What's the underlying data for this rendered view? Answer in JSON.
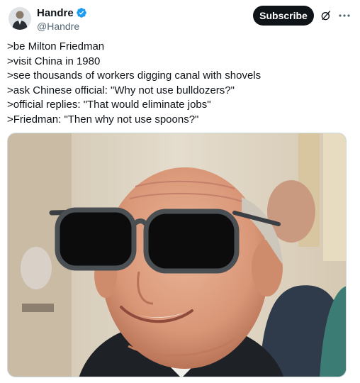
{
  "author": {
    "display_name": "Handre",
    "handle": "@Handre",
    "verified": true
  },
  "actions": {
    "subscribe_label": "Subscribe"
  },
  "icons": {
    "verified": "verified-badge-icon",
    "grok": "grok-icon",
    "more": "more-options-icon"
  },
  "post": {
    "lines": [
      ">be Milton Friedman",
      ">visit China in 1980",
      ">see thousands of workers digging canal with shovels",
      ">ask Chinese official: \"Why not use bulldozers?\"",
      ">official replies: \"That would eliminate jobs\"",
      ">Friedman: \"Then why not use spoons?\""
    ]
  },
  "colors": {
    "accent": "#1d9bf0",
    "subscribe_bg": "#0f1419",
    "text_secondary": "#536471"
  }
}
